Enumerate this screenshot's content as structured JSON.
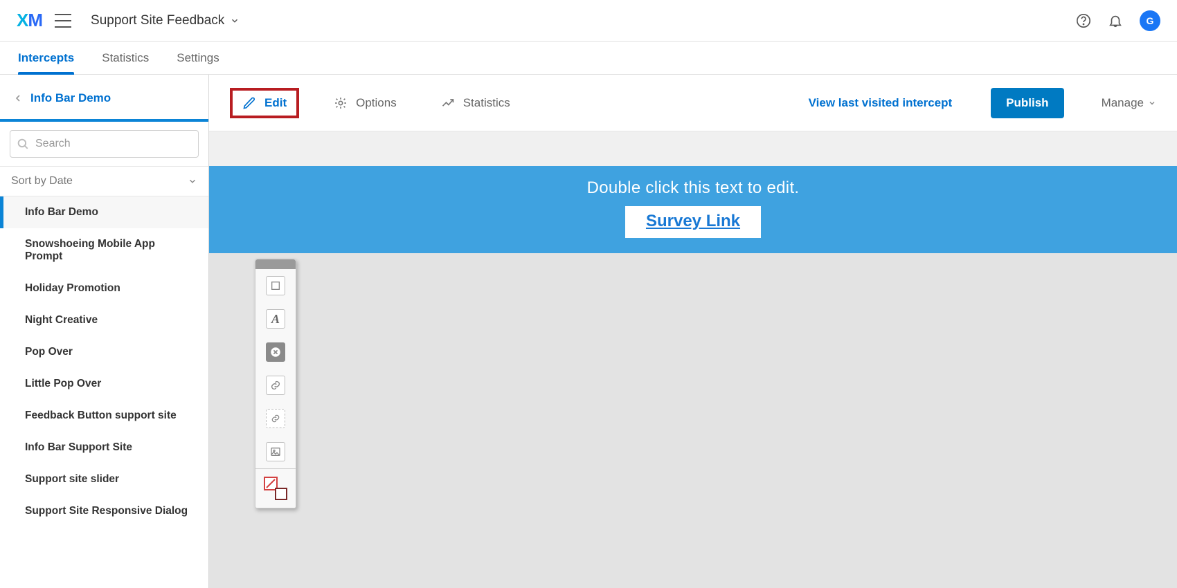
{
  "header": {
    "project_title": "Support Site Feedback",
    "avatar_initial": "G"
  },
  "tabs": {
    "items": [
      "Intercepts",
      "Statistics",
      "Settings"
    ],
    "active_index": 0
  },
  "sidebar": {
    "crumb_title": "Info Bar Demo",
    "search_placeholder": "Search",
    "sort_label": "Sort by Date",
    "items": [
      "Info Bar Demo",
      "Snowshoeing Mobile App Prompt",
      "Holiday Promotion",
      "Night Creative",
      "Pop Over",
      "Little Pop Over",
      "Feedback Button support site",
      "Info Bar Support Site",
      "Support site slider",
      "Support Site Responsive Dialog"
    ],
    "active_item_index": 0
  },
  "toolbar": {
    "edit_label": "Edit",
    "options_label": "Options",
    "statistics_label": "Statistics",
    "view_last_label": "View last visited intercept",
    "publish_label": "Publish",
    "manage_label": "Manage"
  },
  "canvas": {
    "info_text": "Double click this text to edit.",
    "survey_link_label": "Survey Link"
  },
  "palette": {
    "tools": [
      "box-tool",
      "text-tool",
      "close-tool",
      "link-tool",
      "target-tool",
      "image-tool",
      "colors-tool"
    ]
  },
  "colors": {
    "accent": "#0071d0",
    "info_bar_bg": "#3fa2e0",
    "highlight_border": "#b81d21"
  }
}
